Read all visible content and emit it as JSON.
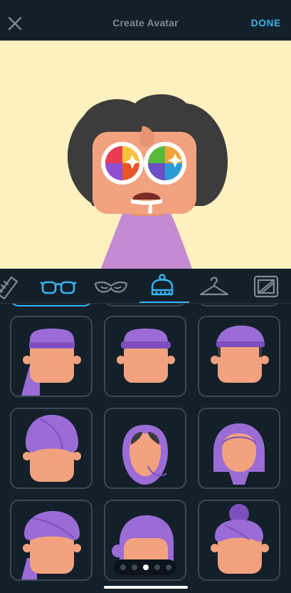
{
  "header": {
    "title": "Create Avatar",
    "done_label": "DONE",
    "close_icon": "close-icon"
  },
  "toolbar": {
    "tabs": [
      {
        "icon": "comb-icon",
        "selected": false
      },
      {
        "icon": "glasses-icon",
        "selected": false
      },
      {
        "icon": "mustache-icon",
        "selected": false
      },
      {
        "icon": "hat-icon",
        "selected": true
      },
      {
        "icon": "hanger-icon",
        "selected": false
      },
      {
        "icon": "background-frame-icon",
        "selected": false
      }
    ]
  },
  "colors": {
    "accent": "#39b4f0",
    "background": "#13202a",
    "preview_bg": "#fef1bf",
    "skin": "#f2a27e",
    "headwear": "#9b6cd6",
    "hair": "#3c3c3c",
    "shirt": "#c58ad1"
  },
  "pager": {
    "total": 5,
    "active_index": 2
  }
}
